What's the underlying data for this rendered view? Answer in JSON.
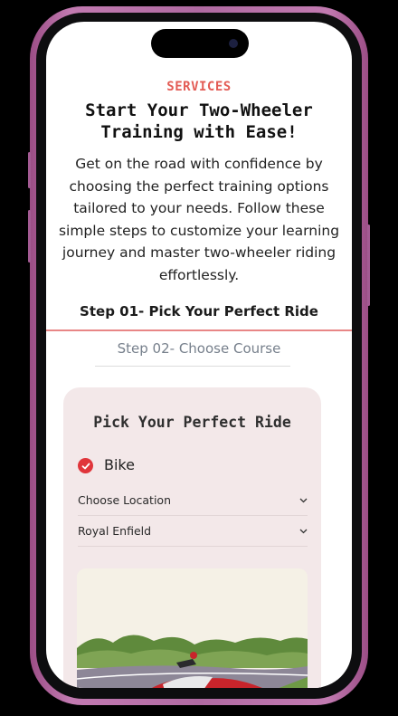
{
  "header": {
    "eyebrow": "SERVICES",
    "title_line1": "Start Your Two-Wheeler",
    "title_line2": "Training with Ease!",
    "description": "Get on the road with confidence by choosing the perfect training options tailored to your needs. Follow these simple steps to customize your learning journey and master two-wheeler riding effortlessly."
  },
  "steps": [
    {
      "label": "Step 01- Pick Your Perfect Ride",
      "active": true
    },
    {
      "label": "Step 02- Choose Course",
      "active": false
    }
  ],
  "card": {
    "title": "Pick Your Perfect Ride",
    "vehicle_option": {
      "label": "Bike",
      "checked": true
    },
    "location_select": {
      "value": "Choose Location"
    },
    "model_select": {
      "value": "Royal Enfield"
    }
  },
  "icons": {
    "check": "check-circle-icon",
    "chevron": "chevron-down-icon"
  },
  "colors": {
    "accent": "#e35c55",
    "check": "#e0353b",
    "card_bg": "#f3e8e9",
    "frame": "#b06aa2"
  }
}
